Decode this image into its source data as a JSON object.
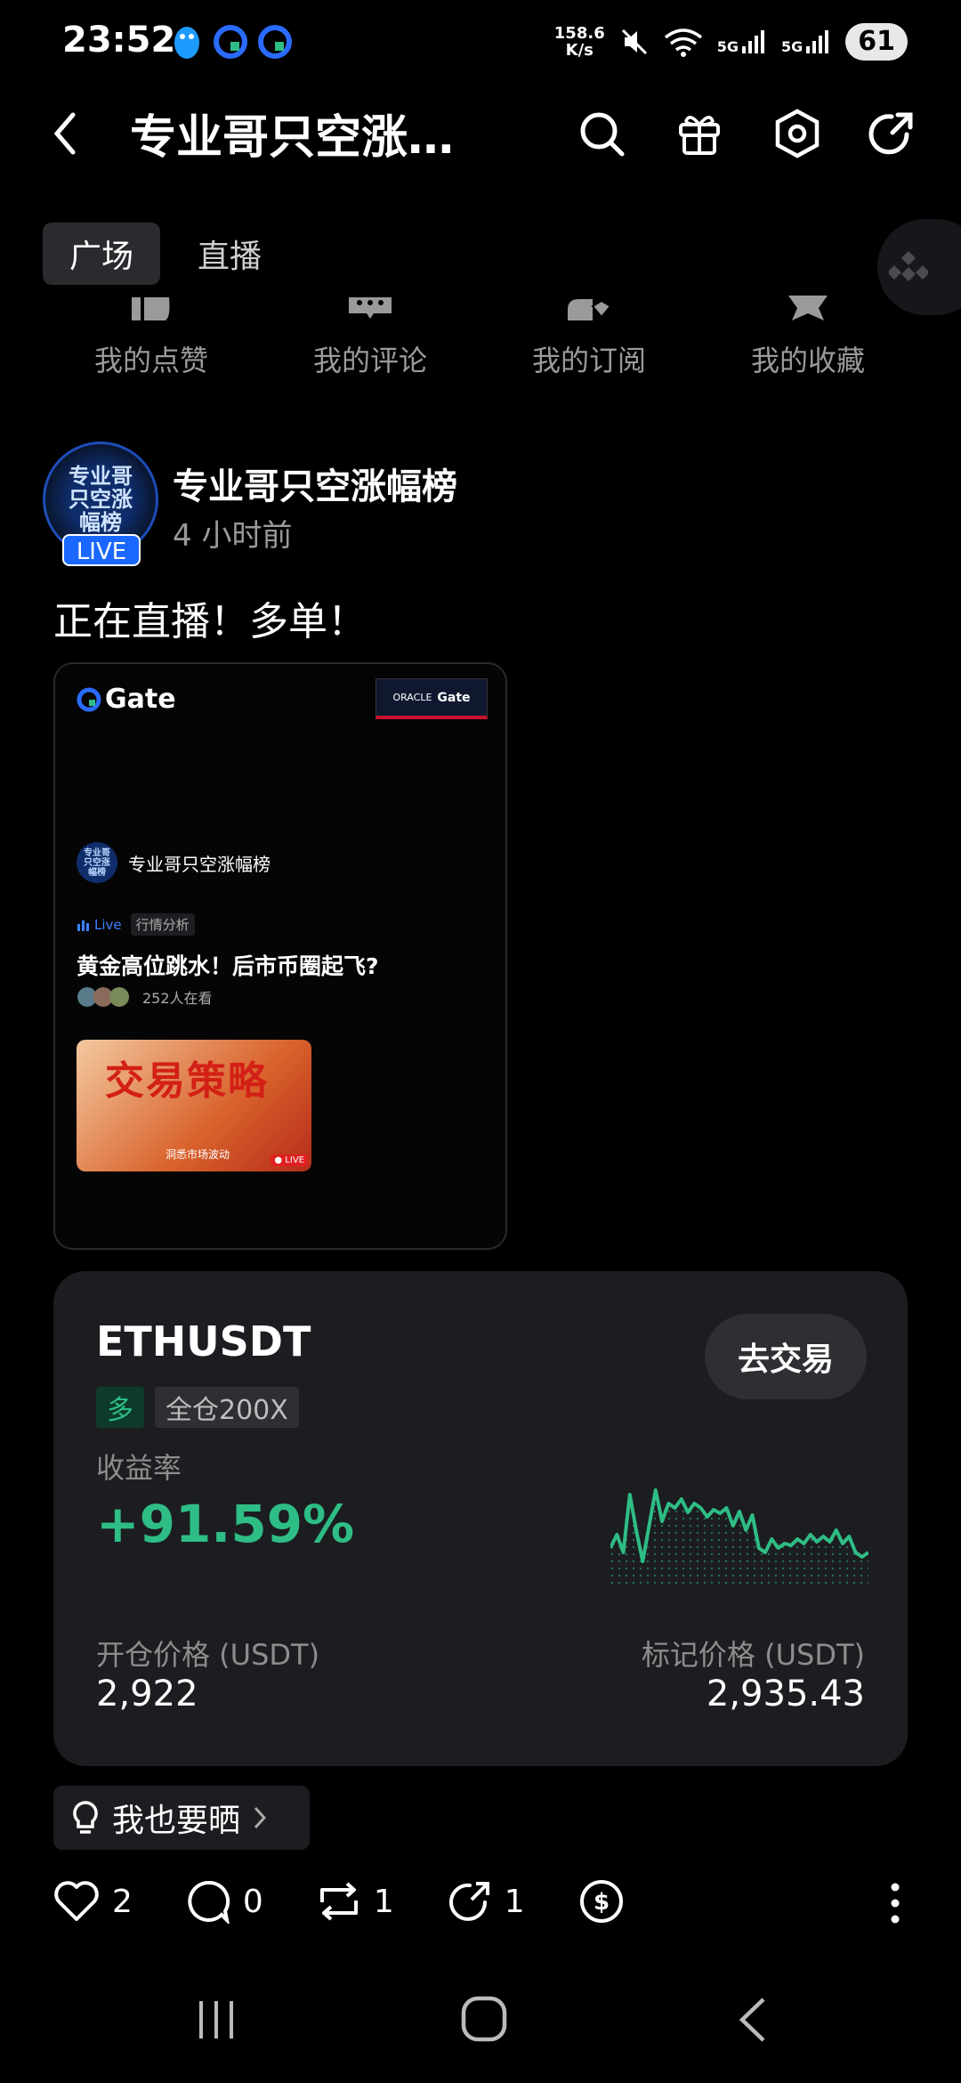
{
  "status": {
    "time": "23:52",
    "net_speed_top": "158.6",
    "net_speed_bottom": "K/s",
    "battery": "61",
    "signal_1": "5G",
    "signal_2": "5G"
  },
  "header": {
    "title": "专业哥只空涨…"
  },
  "tabs": [
    {
      "label": "广场"
    },
    {
      "label": "直播"
    }
  ],
  "quick_actions": [
    {
      "label": "我的点赞"
    },
    {
      "label": "我的评论"
    },
    {
      "label": "我的订阅"
    },
    {
      "label": "我的收藏"
    }
  ],
  "post": {
    "avatar_text": "专业哥只空涨幅榜",
    "live_badge": "LIVE",
    "author": "专业哥只空涨幅榜",
    "time": "4 小时前",
    "text": "正在直播！多单！",
    "stream": {
      "brand": "Gate",
      "sponsor_line1": "ORACLE",
      "sponsor_brand": "Gate",
      "host": "专业哥只空涨幅榜",
      "live_tag": "Live",
      "category": "行情分析",
      "title": "黄金高位跳水！后市币圈起飞?",
      "viewers": "252人在看",
      "thumb_title": "交易策略",
      "thumb_sub": "洞悉市场波动",
      "thumb_live": "● LIVE"
    }
  },
  "trade": {
    "symbol": "ETHUSDT",
    "trade_button": "去交易",
    "side": "多",
    "leverage": "全仓200X",
    "roi_label": "收益率",
    "roi": "+91.59%",
    "entry_label": "开仓价格 (USDT)",
    "entry_value": "2,922",
    "mark_label": "标记价格 (USDT)",
    "mark_value": "2,935.43",
    "accent": "#2ebd85"
  },
  "share": {
    "label": "我也要晒"
  },
  "actions": {
    "likes": "2",
    "comments": "0",
    "reposts": "1",
    "shares": "1"
  }
}
